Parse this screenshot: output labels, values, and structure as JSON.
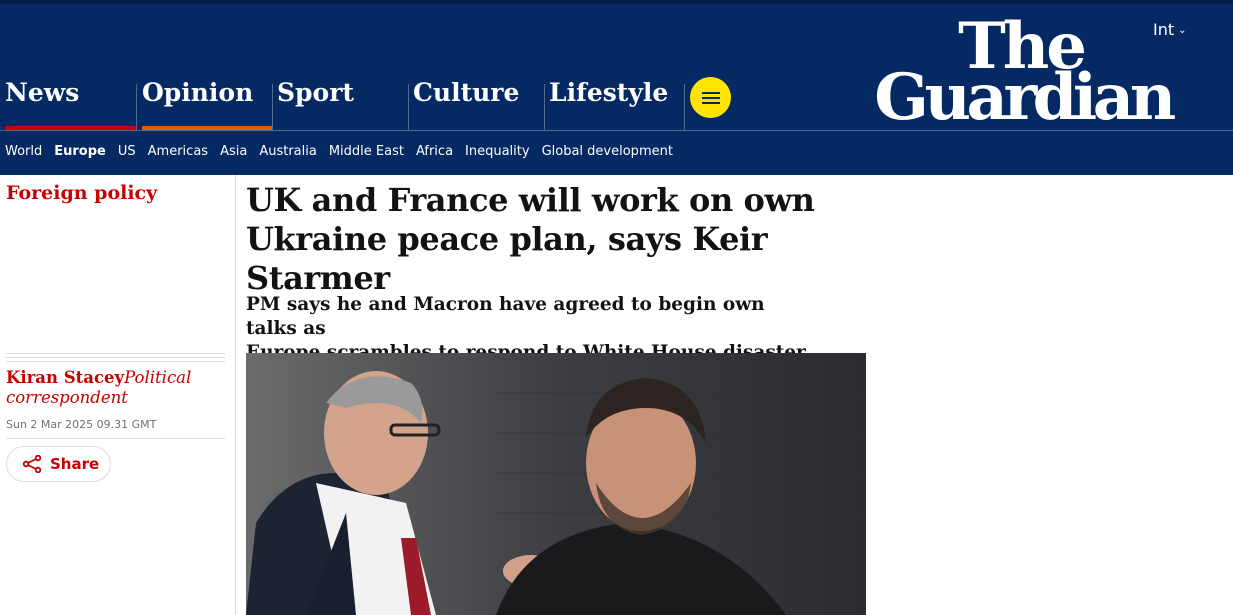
{
  "edition": {
    "label": "Int"
  },
  "logo": {
    "line1": "The",
    "line2": "Guardian"
  },
  "pillars": [
    {
      "label": "News",
      "color": "#c70000"
    },
    {
      "label": "Opinion",
      "color": "#e05e00"
    },
    {
      "label": "Sport",
      "color": ""
    },
    {
      "label": "Culture",
      "color": ""
    },
    {
      "label": "Lifestyle",
      "color": ""
    }
  ],
  "subnav": [
    "World",
    "Europe",
    "US",
    "Americas",
    "Asia",
    "Australia",
    "Middle East",
    "Africa",
    "Inequality",
    "Global development"
  ],
  "subnav_active": "Europe",
  "article": {
    "section": "Foreign policy",
    "headline_line1": "UK and France will work on own",
    "headline_line2": "Ukraine peace plan, says Keir Starmer",
    "standfirst_line1": "PM says he and Macron have agreed to begin own talks as",
    "standfirst_line2": "Europe scrambles to respond to White House disaster",
    "author_name": "Kiran Stacey",
    "author_role": "Political correspondent",
    "date": "Sun 2 Mar 2025 09.31 GMT",
    "share_label": "Share"
  },
  "colors": {
    "brand_blue": "#052962",
    "news_red": "#c70000",
    "opinion_orange": "#e05e00",
    "menu_yellow": "#ffe500"
  }
}
